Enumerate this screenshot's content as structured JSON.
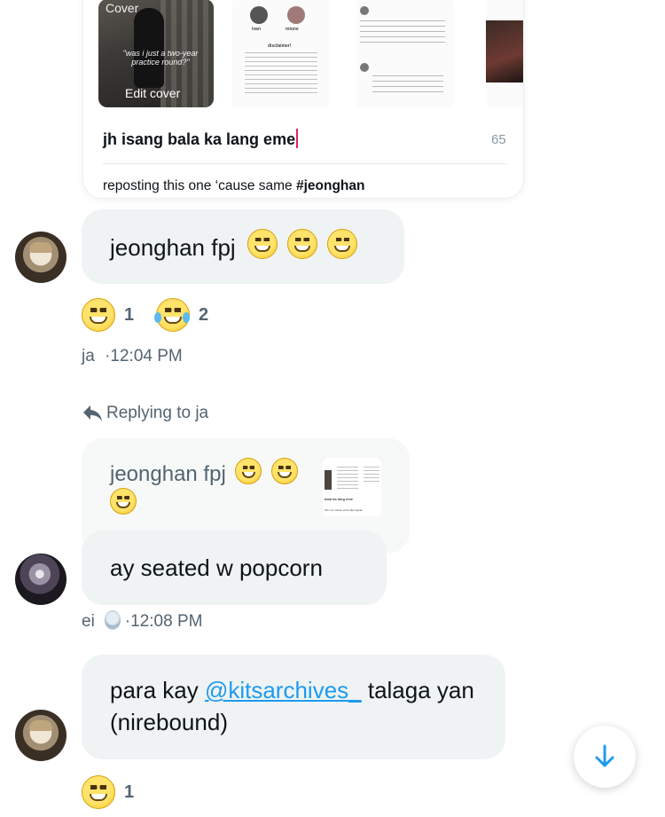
{
  "shared_card": {
    "cover_label": "Cover",
    "cover_quote": "\"was i just a two-year practice round?\"",
    "edit_cover_label": "Edit cover",
    "thumb_names": [
      "ivan",
      "mione"
    ],
    "thumb_heading": "disclaimer!",
    "caption": "jh isang bala ka lang eme",
    "char_count": "65",
    "reposting_text": "reposting this one ‘cause same ",
    "reposting_tag": "#jeonghan"
  },
  "messages": [
    {
      "text": "jeonghan fpj",
      "reactions": [
        {
          "emoji": "😆",
          "count": "1"
        },
        {
          "emoji": "😂",
          "count": "2"
        }
      ],
      "sender": "ja",
      "time": "12:04 PM"
    },
    {
      "reply_label": "Replying to ja",
      "quoted_text": "jeonghan fpj",
      "quoted_snippet_caption": "bala ka lang eme",
      "quoted_snippet_sub": "this one ‘cause same #jeonghan",
      "text": "ay seated w popcorn",
      "sender": "ei",
      "time": "12:08 PM"
    },
    {
      "text_before": "para kay ",
      "mention": "@kitsarchives_",
      "text_after": " talaga yan (nirebound)",
      "reactions": [
        {
          "emoji": "😆",
          "count": "1"
        }
      ]
    }
  ],
  "icons": {
    "reply": "reply-arrow-icon",
    "scroll_down": "arrow-down-icon"
  },
  "colors": {
    "accent": "#1d9bf0",
    "bubble": "#eff3f4",
    "muted": "#536471"
  }
}
